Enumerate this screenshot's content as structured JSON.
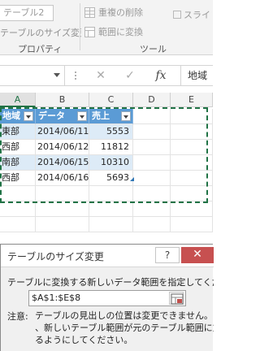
{
  "ribbon": {
    "table_name": "テーブル2",
    "resize_table_label": "テーブルのサイズ変更",
    "group_properties": "プロパティ",
    "group_tools": "ツール",
    "remove_duplicates_label": "重複の削除",
    "convert_to_range_label": "範囲に変換",
    "slicer_label": "スライ"
  },
  "formula_bar": {
    "name_box": "",
    "cancel_glyph": "✕",
    "enter_glyph": "✓",
    "fx_glyph": "fx",
    "content": "地域"
  },
  "columns": [
    "A",
    "B",
    "C",
    "D",
    "E"
  ],
  "table": {
    "headers": [
      "地域",
      "データ",
      "売上"
    ],
    "rows": [
      [
        "東部",
        "2014/06/11",
        "5553"
      ],
      [
        "西部",
        "2014/06/12",
        "11812"
      ],
      [
        "南部",
        "2014/06/15",
        "10310"
      ],
      [
        "西部",
        "2014/06/16",
        "5693"
      ]
    ]
  },
  "dialog": {
    "title": "テーブルのサイズ変更",
    "help_glyph": "?",
    "close_glyph": "✕",
    "prompt": "テーブルに変換する新しいデータ範囲を指定してください(S):",
    "range_value": "$A$1:$E$8",
    "note_label": "注意:",
    "note_lines": [
      "テーブルの見出しの位置は変更できません。また、",
      "、新しいテーブル範囲が元のテーブル範囲に重な",
      "るようにしてください。"
    ]
  },
  "colors": {
    "accent_green": "#217346",
    "table_header_blue": "#5b9bd5",
    "table_band_blue": "#ddebf7",
    "close_red": "#c75050"
  }
}
